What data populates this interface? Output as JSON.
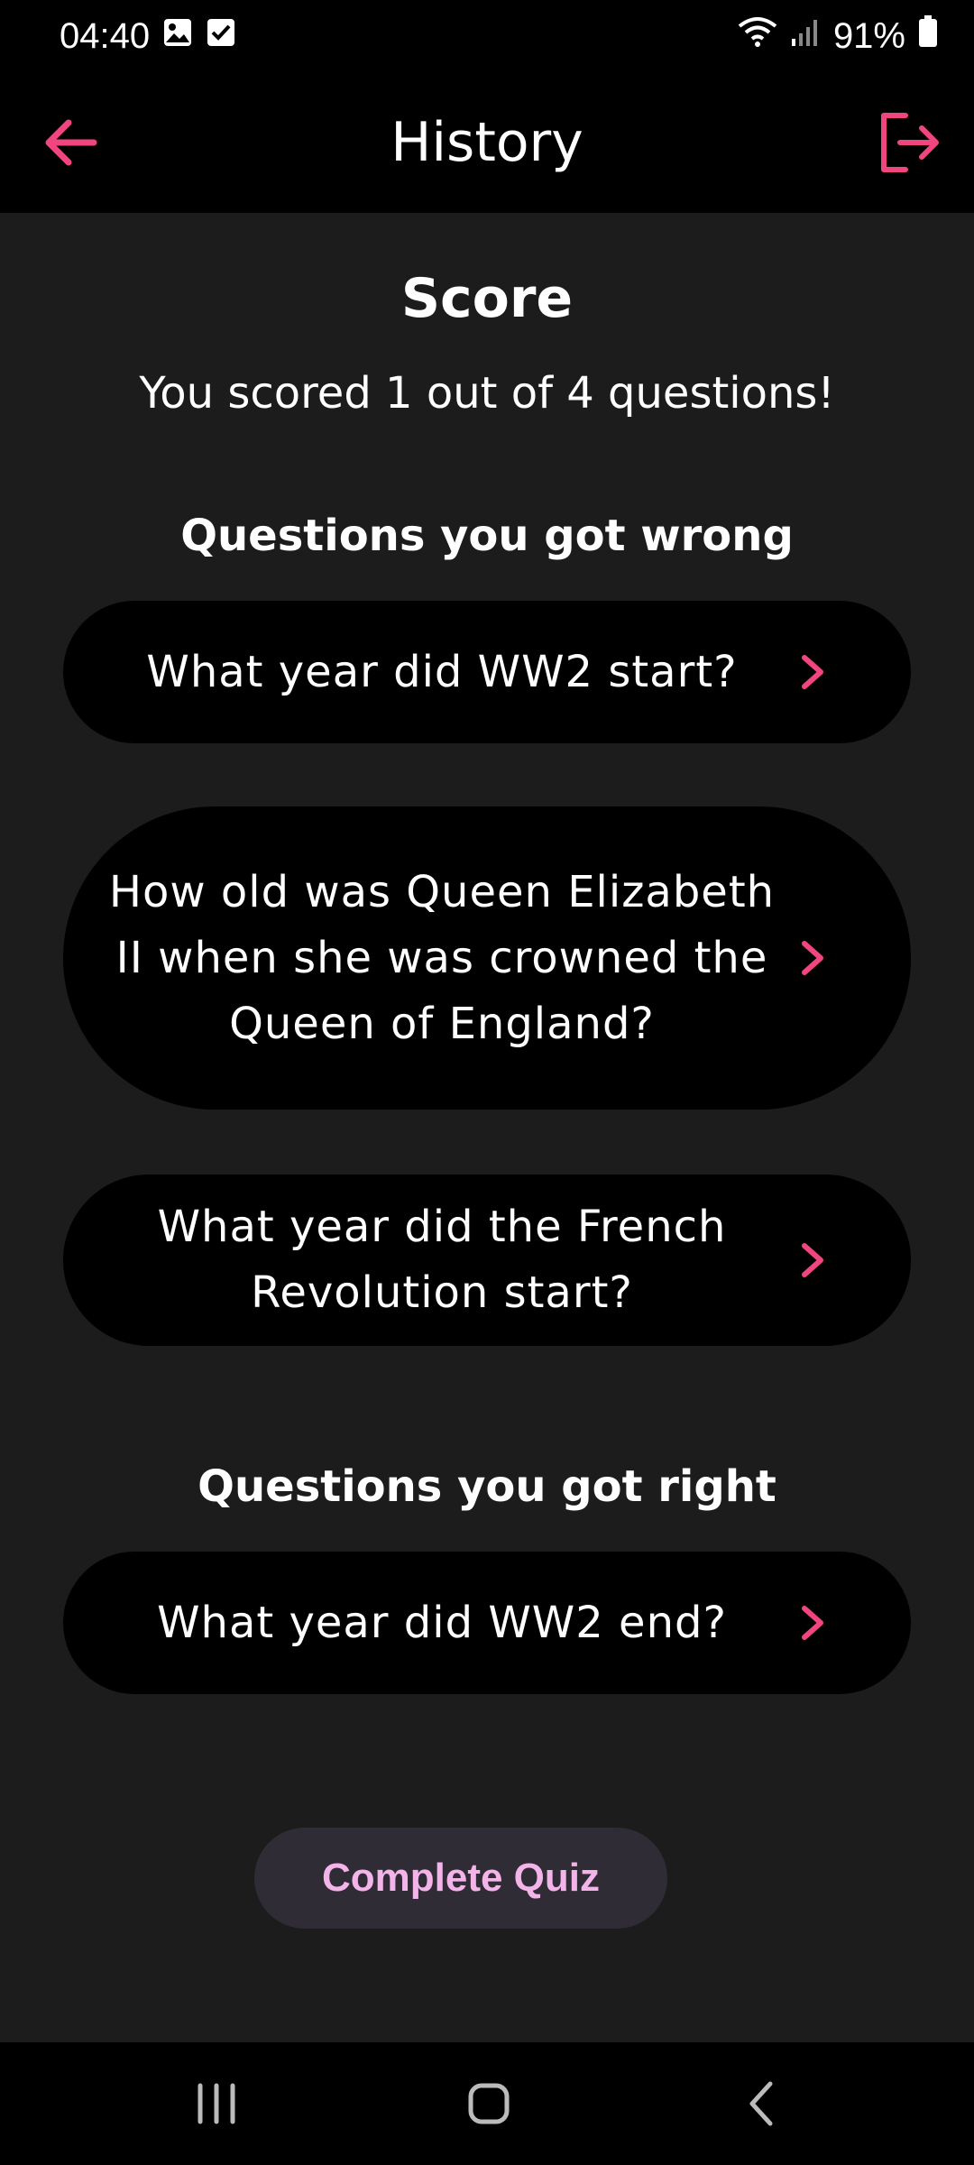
{
  "status_bar": {
    "time": "04:40",
    "battery": "91%",
    "icons": [
      "image-notification-icon",
      "checkbox-notification-icon",
      "wifi-icon",
      "signal-icon",
      "battery-icon"
    ]
  },
  "app_bar": {
    "title": "History",
    "back_icon": "arrow-left-icon",
    "logout_icon": "logout-icon"
  },
  "score": {
    "title": "Score",
    "text": "You scored 1 out of 4 questions!"
  },
  "wrong_section": {
    "heading": "Questions you got wrong",
    "questions": [
      "What year did WW2 start?",
      "How old was Queen Elizabeth II when she was crowned the Queen of England?",
      "What year did the French Revolution start?"
    ]
  },
  "right_section": {
    "heading": "Questions you got right",
    "questions": [
      "What year did WW2 end?"
    ]
  },
  "complete_button": {
    "label": "Complete Quiz"
  },
  "colors": {
    "accent": "#f0457e",
    "background": "#1c1c1c",
    "card": "#000000",
    "button_bg": "#302c36",
    "button_text": "#f3b4ea"
  }
}
